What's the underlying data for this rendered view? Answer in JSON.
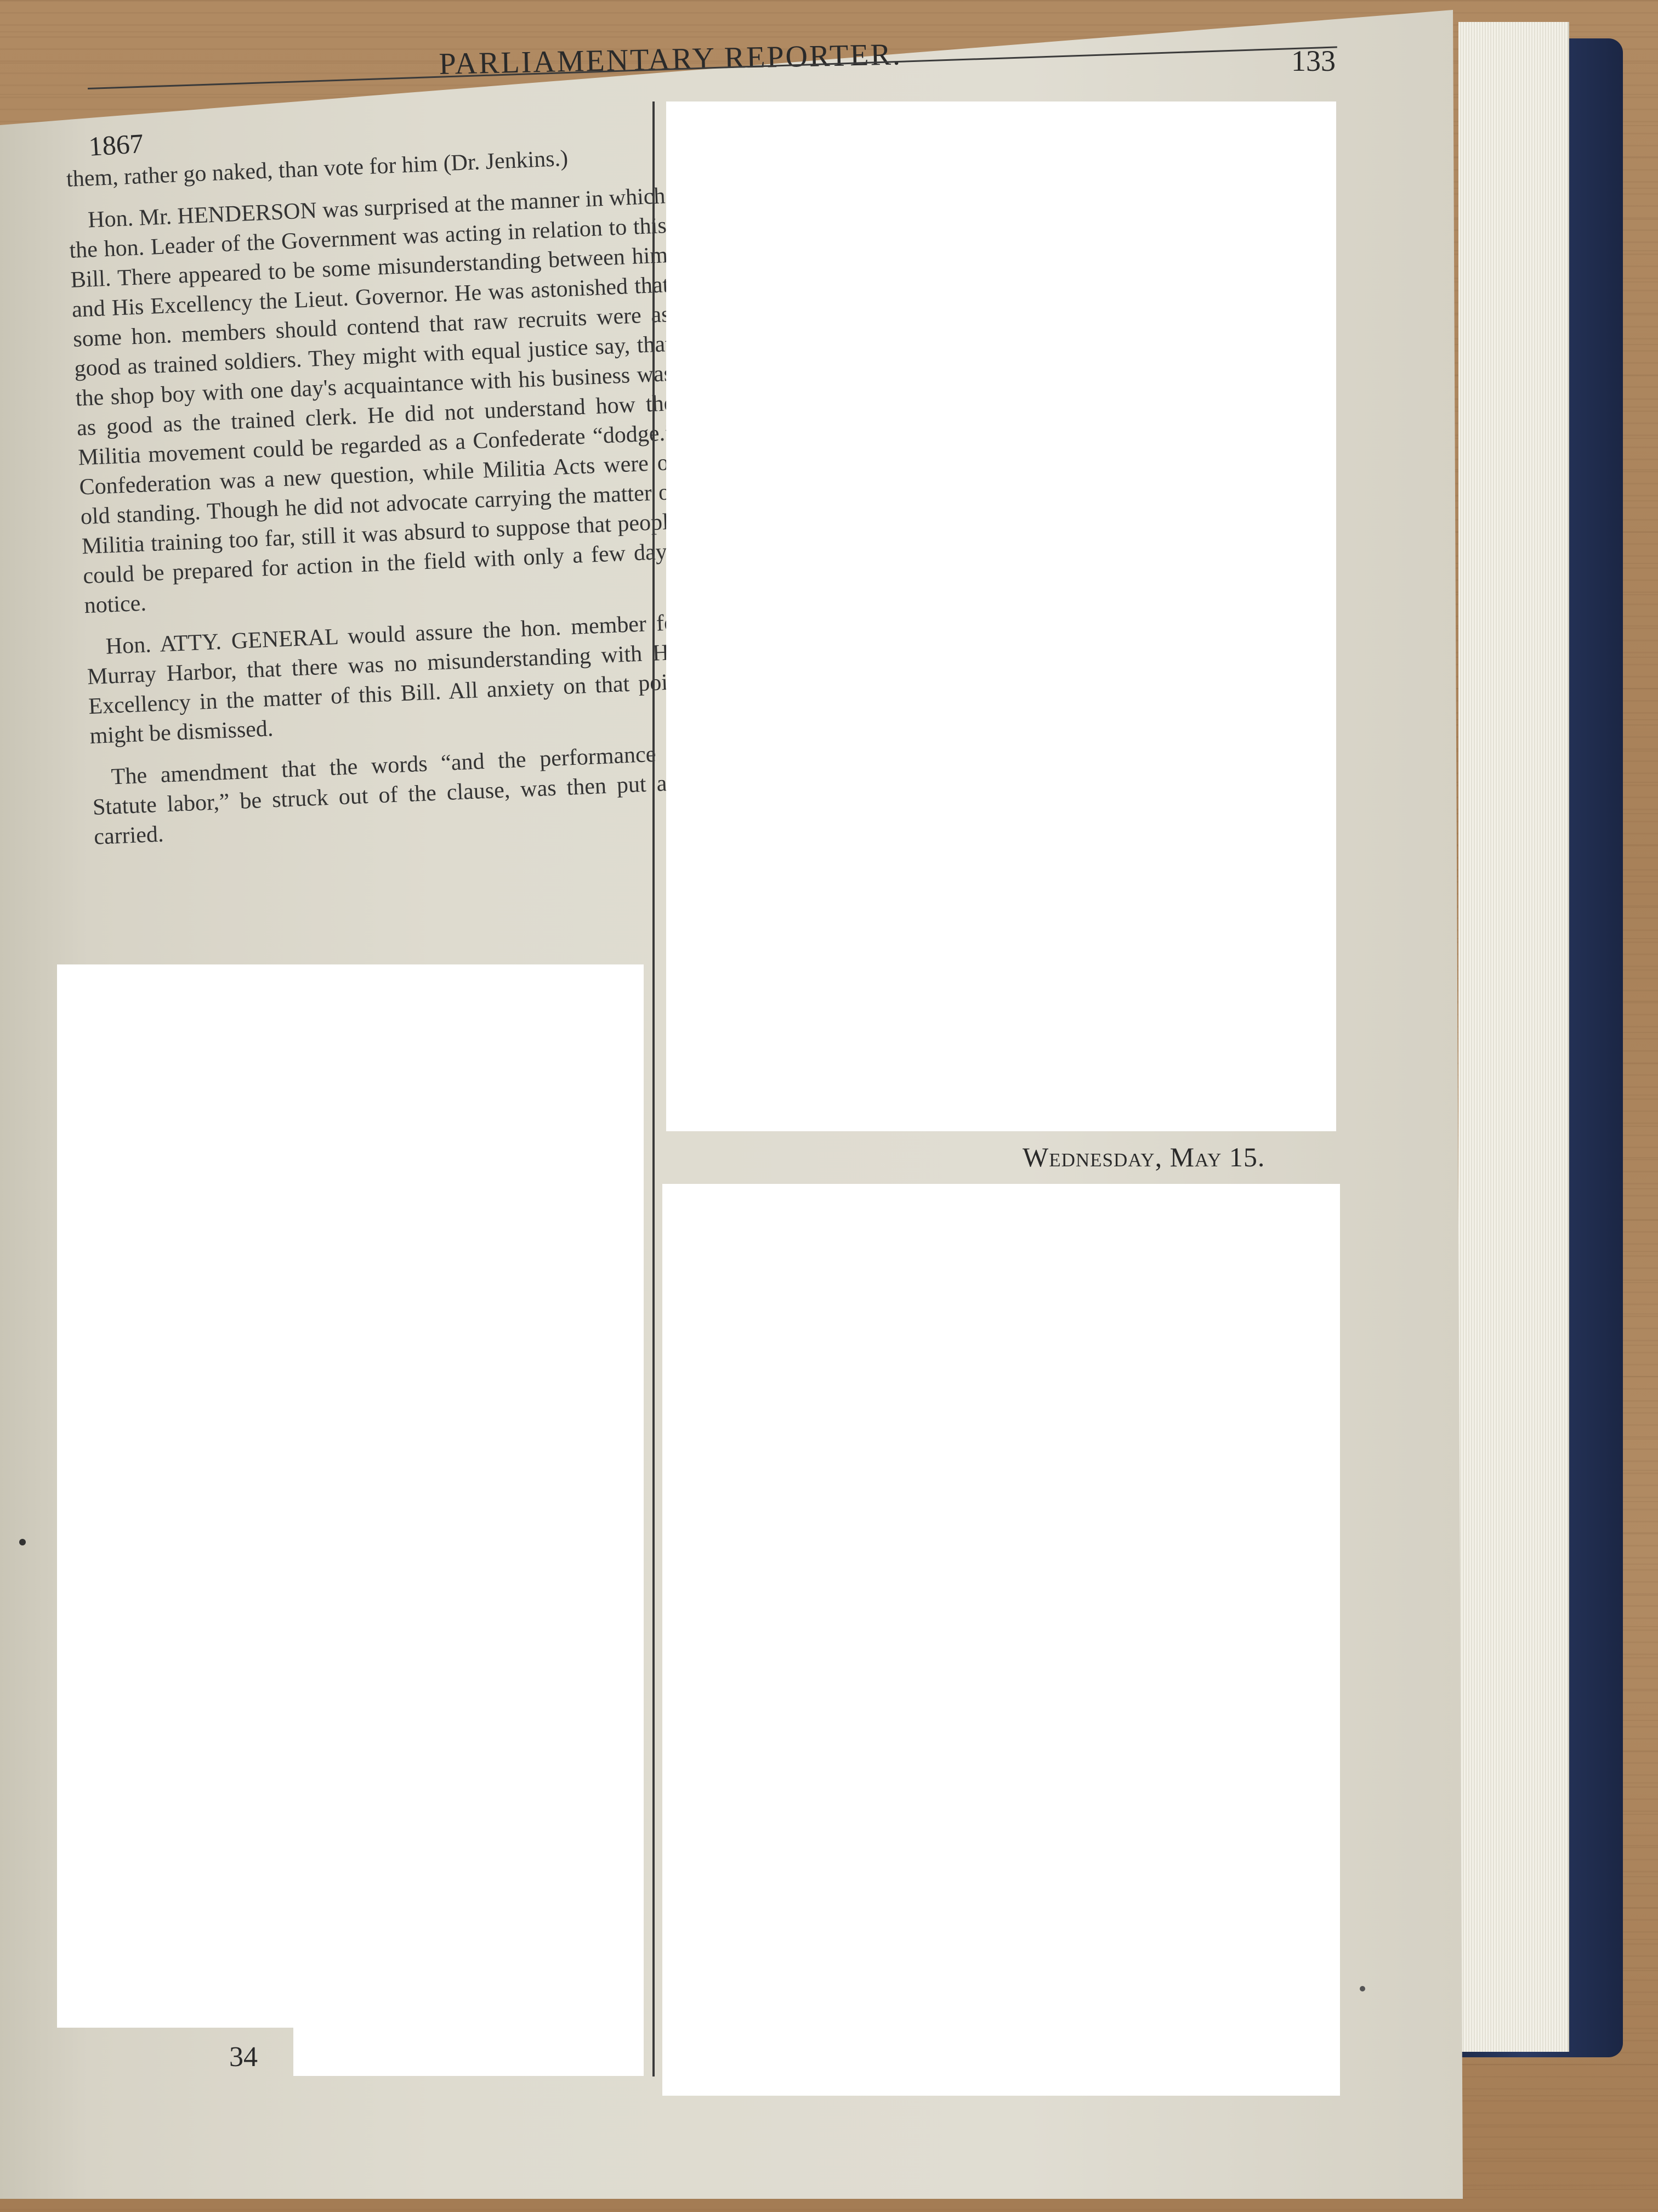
{
  "header": {
    "title": "PARLIAMENTARY REPORTER.",
    "page_number": "133",
    "year": "1867"
  },
  "left_column": {
    "paragraphs": [
      "them, rather go naked, than vote for him (Dr. Jenkins.)",
      "Hon. Mr. HENDERSON was surprised at the manner in which the hon. Leader of the Government was acting in relation to this Bill. There appeared to be some misunderstanding between him and His Excellency the Lieut. Governor. He was astonished that some hon. members should contend that raw recruits were as good as trained soldiers. They might with equal justice say, that the shop boy with one day's acquaintance with his business was as good as the trained clerk. He did not understand how the Militia movement could be regarded as a Confederate “dodge.” Confederation was a new question, while Militia Acts were of old standing. Though he did not advocate carrying the matter of Militia training too far, still it was absurd to suppose that people could be prepared for action in the field with only a few days' notice.",
      "Hon. ATTY. GENERAL would assure the hon. member for Murray Harbor, that there was no misunderstanding with His Excellency in the matter of this Bill. All anxiety on that point might be dismissed.",
      "The amendment that the words “and the performance of Statute labor,” be struck out of the clause, was then put and carried."
    ]
  },
  "right_column": {
    "date_heading": "Wednesday, May 15."
  },
  "footer": {
    "signature": "34"
  },
  "colors": {
    "paper": "#dedbcf",
    "ink": "#2b2b2b",
    "cover": "#2a3a63",
    "wood": "#a9845e"
  }
}
